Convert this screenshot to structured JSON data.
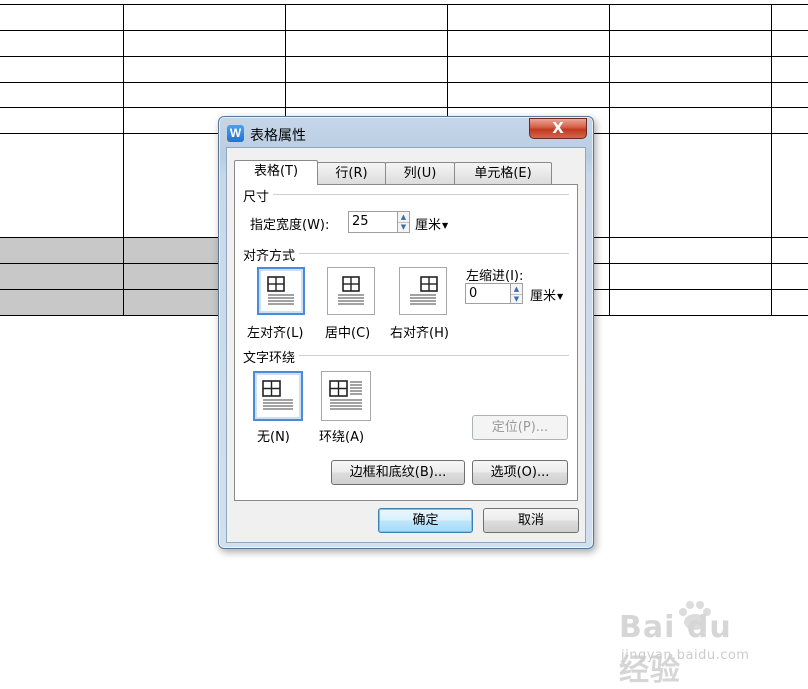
{
  "dialog": {
    "title": "表格属性",
    "app_icon": "W",
    "close_icon": "X",
    "tabs": [
      {
        "label": "表格(T)",
        "active": true
      },
      {
        "label": "行(R)",
        "active": false
      },
      {
        "label": "列(U)",
        "active": false
      },
      {
        "label": "单元格(E)",
        "active": false
      }
    ],
    "size_group": {
      "title": "尺寸",
      "width_label": "指定宽度(W):",
      "width_value": "25",
      "width_unit": "厘米"
    },
    "align_group": {
      "title": "对齐方式",
      "options": [
        {
          "label": "左对齐(L)",
          "icon": "table-align-left-icon",
          "selected": true
        },
        {
          "label": "居中(C)",
          "icon": "table-align-center-icon",
          "selected": false
        },
        {
          "label": "右对齐(H)",
          "icon": "table-align-right-icon",
          "selected": false
        }
      ],
      "indent_label": "左缩进(I):",
      "indent_value": "0",
      "indent_unit": "厘米"
    },
    "wrap_group": {
      "title": "文字环绕",
      "options": [
        {
          "label": "无(N)",
          "icon": "wrap-none-icon",
          "selected": true
        },
        {
          "label": "环绕(A)",
          "icon": "wrap-around-icon",
          "selected": false
        }
      ],
      "position_button": "定位(P)..."
    },
    "borders_button": "边框和底纹(B)...",
    "options_button": "选项(O)...",
    "ok_button": "确定",
    "cancel_button": "取消"
  },
  "watermark": {
    "logo_text": "Bai du 经验",
    "url": "jingyan.baidu.com"
  },
  "colors": {
    "selection_border": "#4a8ad8",
    "close_button": "#c0391f",
    "shaded_rows": "#c8c8c8"
  }
}
